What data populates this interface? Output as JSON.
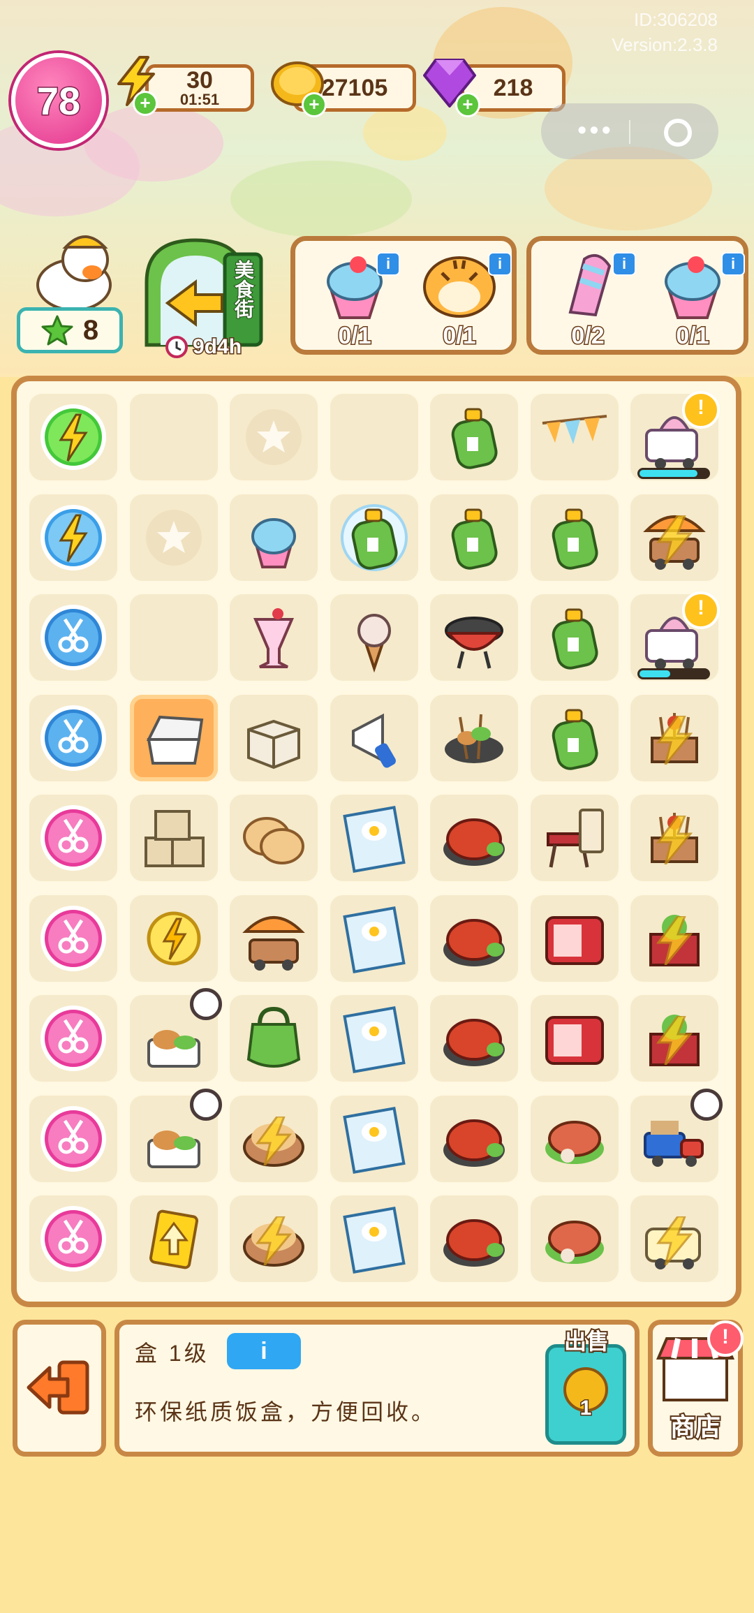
{
  "meta": {
    "player_id": "ID:306208",
    "version": "Version:2.3.8"
  },
  "level": "78",
  "energy": {
    "value": "30",
    "timer": "01:51",
    "icon": "lightning-icon"
  },
  "coins": {
    "value": "27105",
    "icon": "coin-icon"
  },
  "gems": {
    "value": "218",
    "icon": "gem-icon"
  },
  "character": {
    "star_count": "8"
  },
  "event": {
    "gate_label": "美食街",
    "timer": "9d4h"
  },
  "orders": [
    {
      "items": [
        {
          "name": "shaved-ice-bowl",
          "progress": "0/1"
        },
        {
          "name": "tiger-customer",
          "progress": "0/1"
        }
      ]
    },
    {
      "items": [
        {
          "name": "unicorn-popsicle",
          "progress": "0/2"
        },
        {
          "name": "shaved-ice-bowl",
          "progress": "0/1"
        }
      ]
    }
  ],
  "board": {
    "rows": [
      [
        "energy-orb-green",
        "empty",
        "locked-star",
        "empty",
        "gas-canister",
        "bunting-flags",
        "ice-cream-cart"
      ],
      [
        "energy-orb-blue",
        "locked-star",
        "shaved-ice",
        "bubble-gas-canister",
        "gas-canister",
        "gas-canister",
        "parasol-cart-locked"
      ],
      [
        "scissors-orb-blue",
        "empty",
        "parfait-glass",
        "ice-cream-cone",
        "bbq-grill",
        "gas-canister",
        "ice-cream-cart"
      ],
      [
        "scissors-orb-blue",
        "takeout-box-open",
        "cardboard-box",
        "megaphone",
        "skewer-plate",
        "gas-canister",
        "skewer-stand-locked"
      ],
      [
        "scissors-orb-pink",
        "box-stack",
        "flatbread",
        "egg-poster",
        "crayfish-plate",
        "folding-table",
        "skewer-stand-locked"
      ],
      [
        "scissors-orb-pink",
        "energy-coin",
        "parasol-cart",
        "egg-poster",
        "crayfish-plate",
        "red-fridge",
        "plant-crate-locked"
      ],
      [
        "scissors-orb-pink",
        "chicken-lunchbox",
        "green-backpack",
        "egg-poster",
        "crayfish-plate",
        "red-fridge",
        "plant-crate-locked"
      ],
      [
        "scissors-orb-pink",
        "chicken-lunchbox",
        "flatbread-basket-locked",
        "egg-poster",
        "crayfish-plate",
        "bacon-plate",
        "delivery-truck"
      ],
      [
        "scissors-orb-pink",
        "upgrade-card",
        "flatbread-basket-locked",
        "egg-poster",
        "crayfish-plate",
        "bacon-plate",
        "food-cart-locked"
      ]
    ],
    "selected": "takeout-box-open"
  },
  "selected_item": {
    "title": "盒 1级",
    "info_label": "i",
    "description": "环保纸质饭盒，方便回收。",
    "sell_label": "出售",
    "sell_price": "1"
  },
  "shop": {
    "label": "商店",
    "badge": "!"
  },
  "colors": {
    "accent": "#c88845",
    "energy": "#ffd21e",
    "coin": "#f5b81a",
    "gem": "#b049e0",
    "sell": "#3ed0cf"
  }
}
